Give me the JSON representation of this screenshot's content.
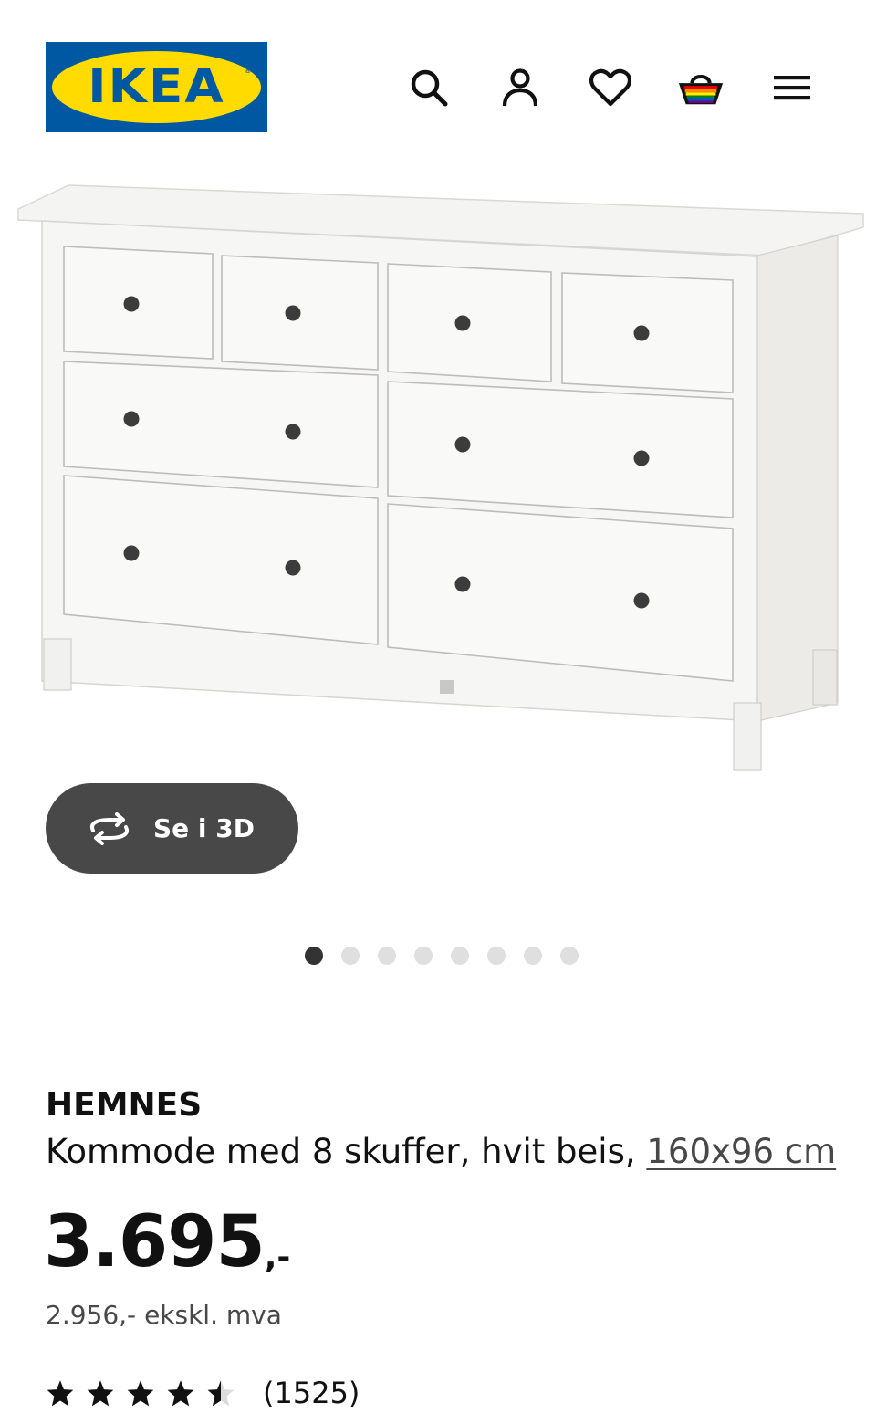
{
  "header": {
    "logo_text": "IKEA",
    "logo_registered": "®",
    "icons": [
      "search-icon",
      "account-icon",
      "favourites-icon",
      "basket-icon",
      "menu-icon"
    ]
  },
  "gallery": {
    "view_3d_label": "Se i 3D",
    "image_count": 8,
    "active_index": 0
  },
  "product": {
    "name": "HEMNES",
    "description": "Kommode med 8 skuffer, hvit beis, ",
    "dimensions": "160x96 cm",
    "price": "3.695",
    "price_suffix": ",-",
    "price_ex_vat": "2.956,- ekskl. mva",
    "rating": 4.5,
    "review_count": "(1525)"
  },
  "colors": {
    "ikea_blue": "#0058a3",
    "ikea_yellow": "#ffdb00",
    "button_dark": "#484848"
  }
}
